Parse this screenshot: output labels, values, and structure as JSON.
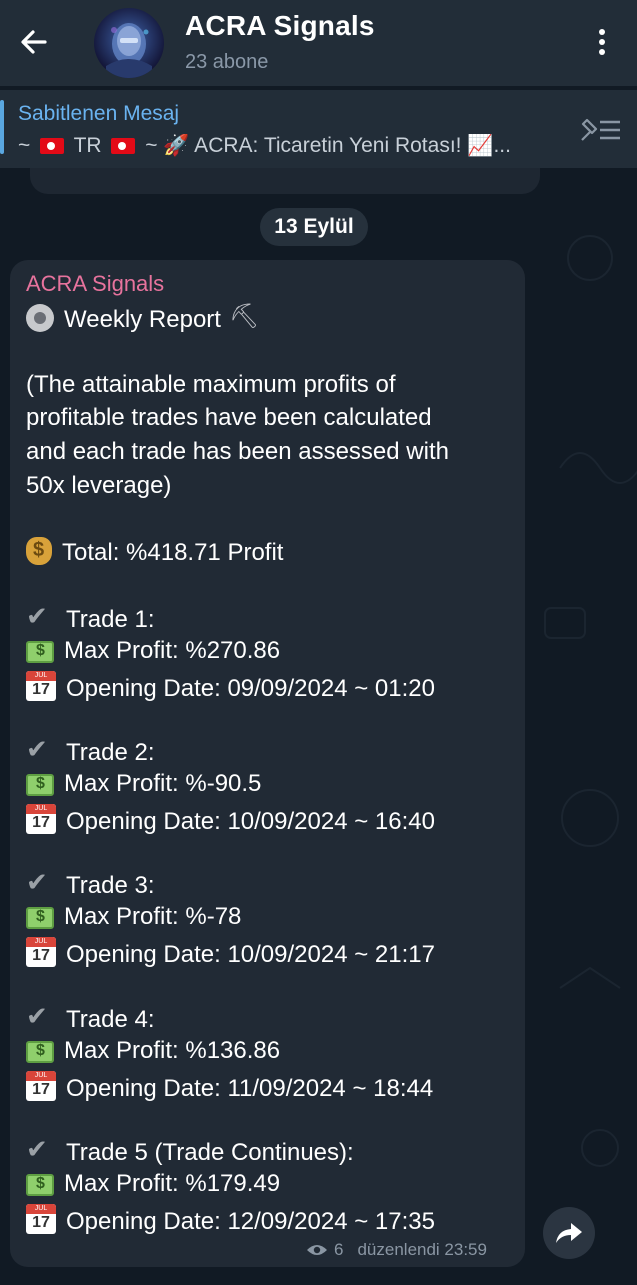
{
  "header": {
    "title": "ACRA Signals",
    "subtitle": "23 abone"
  },
  "pinned": {
    "title": "Sabitlenen Mesaj",
    "text_prefix": "~",
    "text_tr": "TR",
    "text_rest": "~ 🚀 ACRA: Ticaretin Yeni Rotası! 📈..."
  },
  "date_chip": "13 Eylül",
  "message": {
    "sender": "ACRA Signals",
    "heading": "Weekly Report",
    "note_lines": [
      "(The attainable maximum profits of",
      "profitable trades have been calculated",
      "and each trade has been assessed with",
      "50x leverage)"
    ],
    "total": "Total: %418.71 Profit",
    "trades": [
      {
        "title": "Trade 1:",
        "profit": "Max Profit: %270.86",
        "date": "Opening Date: 09/09/2024 ~ 01:20"
      },
      {
        "title": "Trade 2:",
        "profit": "Max Profit: %-90.5",
        "date": "Opening Date: 10/09/2024 ~ 16:40"
      },
      {
        "title": "Trade 3:",
        "profit": "Max Profit: %-78",
        "date": "Opening Date: 10/09/2024 ~ 21:17"
      },
      {
        "title": "Trade 4:",
        "profit": "Max Profit: %136.86",
        "date": "Opening Date: 11/09/2024 ~ 18:44"
      },
      {
        "title": "Trade 5 (Trade Continues):",
        "profit": "Max Profit: %179.49",
        "date": "Opening Date: 12/09/2024 ~ 17:35"
      }
    ],
    "views": "6",
    "edited": "düzenlendi 23:59"
  },
  "icons": {
    "back": "arrow-left-icon",
    "menu": "more-vertical-icon",
    "pinned_list": "pin-list-icon",
    "views": "eye-icon",
    "share": "share-icon"
  },
  "colors": {
    "header_bg": "#222d38",
    "bubble_bg": "#212a35",
    "sender": "#e7739d",
    "pinned_title": "#6ab3f0"
  }
}
